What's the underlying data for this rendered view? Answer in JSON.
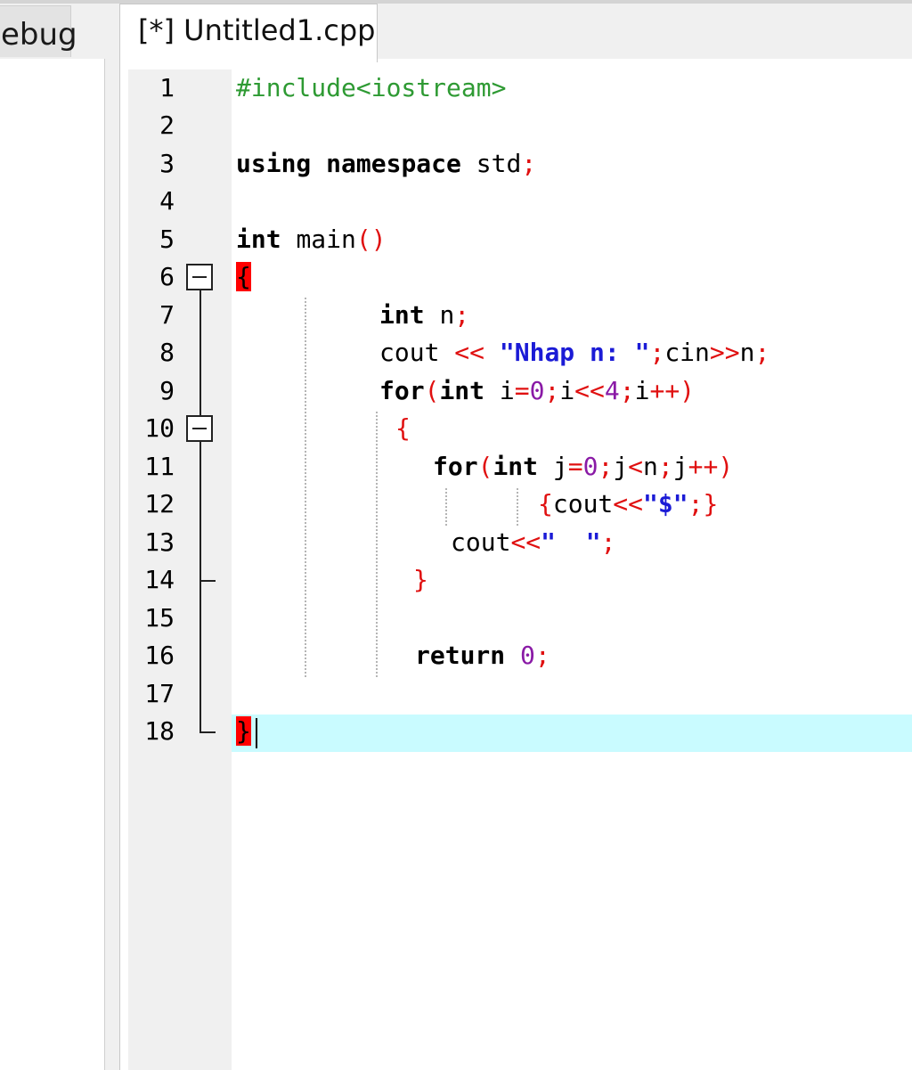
{
  "tabs": {
    "left_panel_tab": "ebug",
    "editor_tab": "[*] Untitled1.cpp"
  },
  "editor": {
    "line_numbers": [
      "1",
      "2",
      "3",
      "4",
      "5",
      "6",
      "7",
      "8",
      "9",
      "10",
      "11",
      "12",
      "13",
      "14",
      "15",
      "16",
      "17",
      "18"
    ],
    "code": {
      "l1_include": "#include<iostream>",
      "l3_using": "using",
      "l3_namespace": "namespace",
      "l3_std": "std",
      "l5_int": "int",
      "l5_main": "main",
      "l7_int": "int",
      "l7_n": "n",
      "l8_cout": "cout",
      "l8_string": "\"Nhap n: \"",
      "l8_cin": "cin",
      "l8_n": "n",
      "l9_for": "for",
      "l9_int": "int",
      "l9_i": "i",
      "l9_zero": "0",
      "l9_i2": "i",
      "l9_four": "4",
      "l9_i3": "i",
      "l11_for": "for",
      "l11_int": "int",
      "l11_j": "j",
      "l11_zero": "0",
      "l11_j2": "j",
      "l11_n": "n",
      "l11_j3": "j",
      "l12_cout": "cout",
      "l12_string": "\"$\"",
      "l13_cout": "cout",
      "l13_string": "\"  \"",
      "l16_return": "return",
      "l16_zero": "0"
    }
  },
  "colors": {
    "preprocessor": "#2e9a33",
    "symbol": "#e01010",
    "string": "#1b1bd6",
    "number": "#8a1aa6",
    "brace_highlight": "#ff0000",
    "current_line": "#c9fbff"
  }
}
